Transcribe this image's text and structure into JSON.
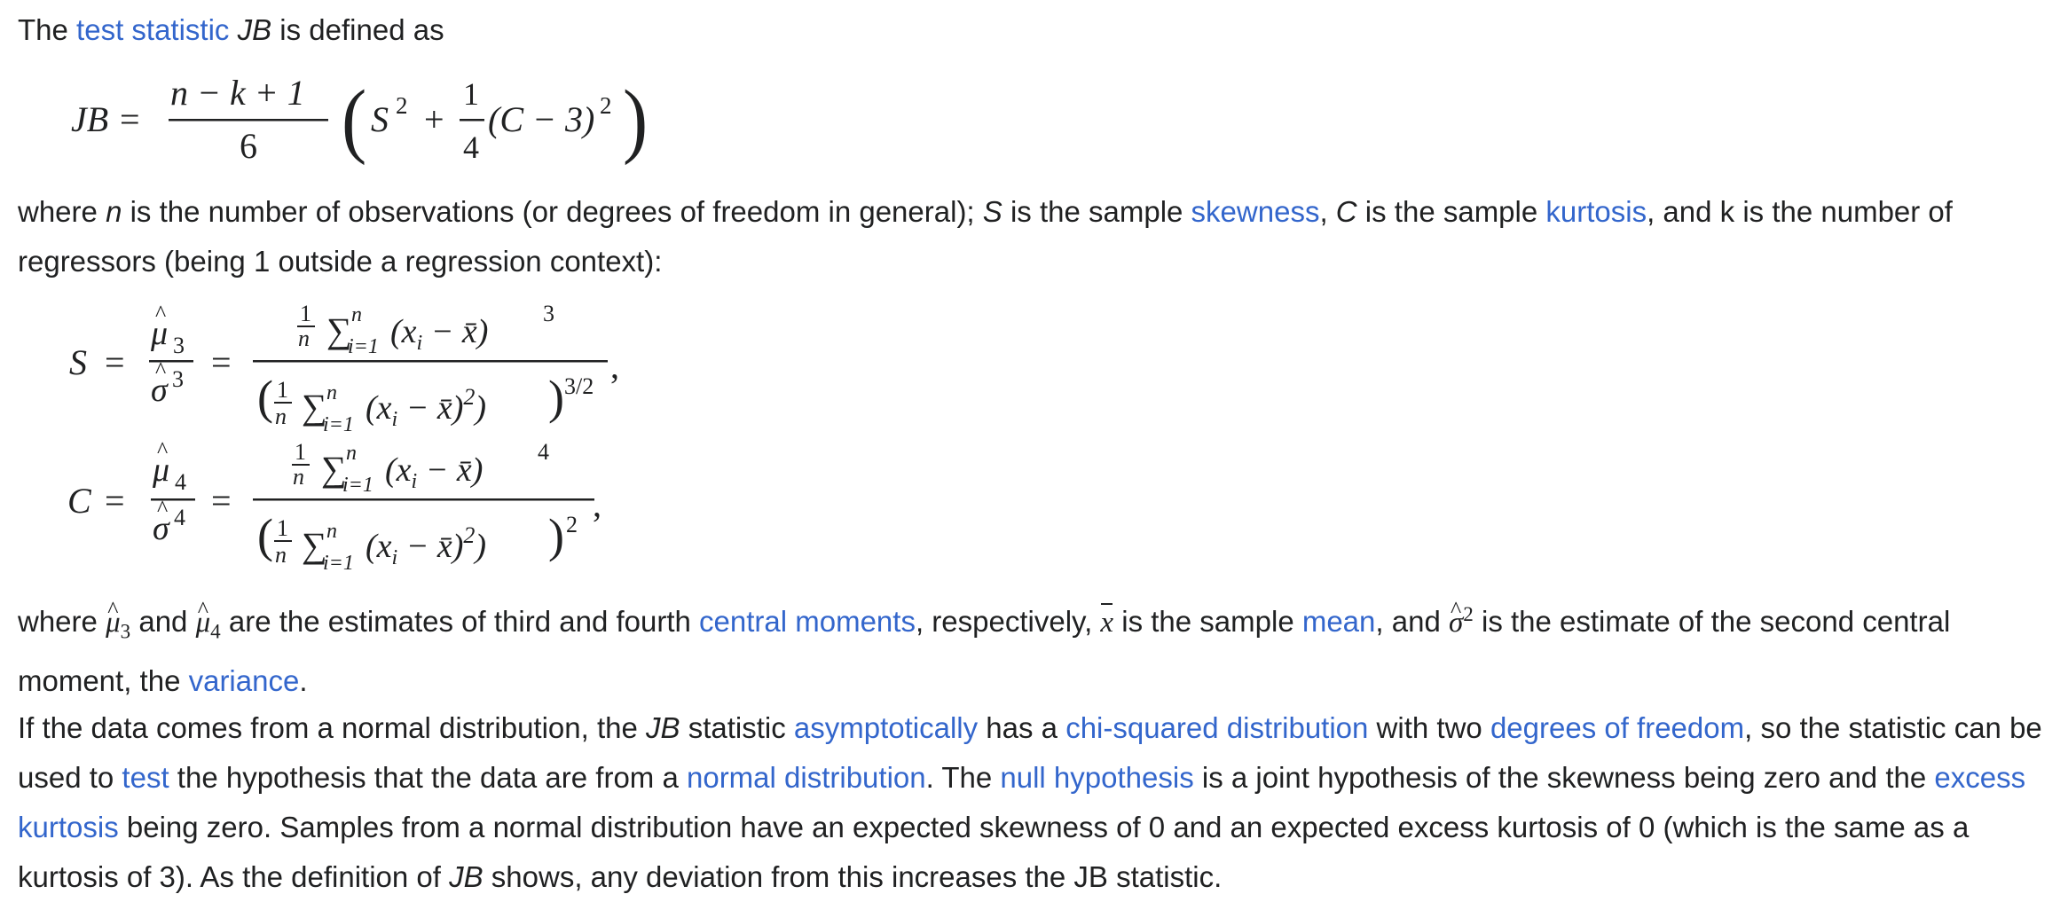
{
  "para1": {
    "t1": "The ",
    "link_test_statistic": "test statistic",
    "jb": "JB",
    "t2": " is defined as"
  },
  "formula_jb": {
    "lhs": "JB",
    "eq": "=",
    "num": "n − k + 1",
    "den": "6",
    "lparen": "(",
    "s": "S",
    "two": "2",
    "plus": "+",
    "frac_num": "1",
    "frac_den": "4",
    "c_term": "(C − 3)",
    "rparen": ")"
  },
  "para2": {
    "t1": "where ",
    "n": "n",
    "t2": " is the number of observations (or degrees of freedom in general); ",
    "s": "S",
    "t3": " is the sample ",
    "link_skewness": "skewness",
    "t4": ", ",
    "c": "C",
    "t5": " is the sample ",
    "link_kurtosis": "kurtosis",
    "t6": ", and k is the number of regressors (being 1 outside a regression context):"
  },
  "formula_s": {
    "lhs": "S",
    "eq1": "=",
    "mu": "μ",
    "mu_sub": "3",
    "sigma": "σ",
    "sigma_sup": "3",
    "eq2": "=",
    "num_one": "1",
    "num_n": "n",
    "sum": "∑",
    "sum_top": "n",
    "sum_bot": "i=1",
    "num_body": "(x",
    "sub_i": "i",
    "minus_xbar": " − x",
    "close": ")",
    "num_pow": "3",
    "den_pow": "2)",
    "outer_pow": "3/2",
    "comma": ","
  },
  "formula_c": {
    "lhs": "C",
    "eq1": "=",
    "mu": "μ",
    "mu_sub": "4",
    "sigma": "σ",
    "sigma_sup": "4",
    "eq2": "=",
    "num_pow": "4",
    "outer_pow": "2",
    "comma": ","
  },
  "para3": {
    "t1": "where ",
    "mu3": "μ",
    "mu3_sub": "3",
    "t2": " and ",
    "mu4": "μ",
    "mu4_sub": "4",
    "t3": " are the estimates of third and fourth ",
    "link_central_moments": "central moments",
    "t4": ", respectively, ",
    "xbar": "x",
    "t5": " is the sample ",
    "link_mean": "mean",
    "t6": ", and ",
    "sigma": "σ",
    "sigma_sup": "2",
    "t7": " is the estimate of the second central moment, the ",
    "link_variance": "variance",
    "t8": "."
  },
  "para4": {
    "t1": "If the data comes from a normal distribution, the ",
    "jb1": "JB",
    "t2": " statistic ",
    "link_asymptotically": "asymptotically",
    "t3": " has a ",
    "link_chi_squared": "chi-squared distribution",
    "t4": " with two ",
    "link_dof": "degrees of freedom",
    "t5": ", so the statistic can be used to ",
    "link_test": "test",
    "t6": " the hypothesis that the data are from a ",
    "link_normal_distribution": "normal distribution",
    "t7": ". The ",
    "link_null_hypothesis": "null hypothesis",
    "t8": " is a joint hypothesis of the skewness being zero and the ",
    "link_excess_kurtosis": "excess kurtosis",
    "t9": " being zero. Samples from a normal distribution have an expected skewness of 0 and an expected excess kurtosis of 0 (which is the same as a kurtosis of 3). As the definition of ",
    "jb2": "JB",
    "t10": " shows, any deviation from this increases the JB statistic."
  }
}
